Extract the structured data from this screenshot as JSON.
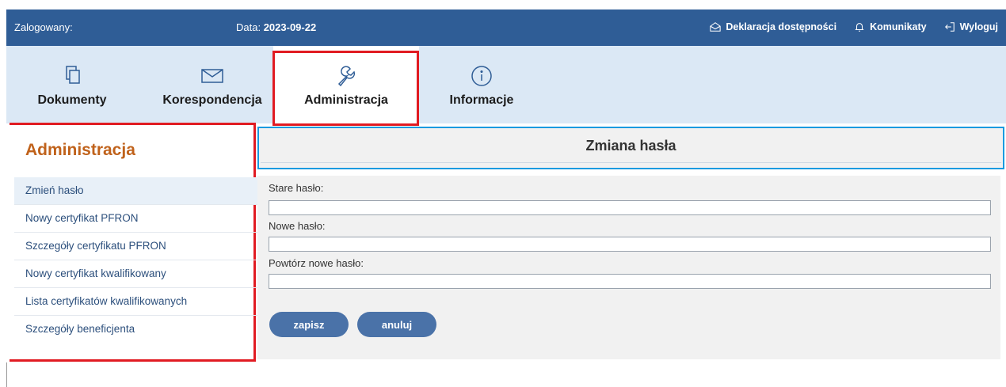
{
  "topbar": {
    "login_label": "Zalogowany:",
    "date_label": "Data:",
    "date_value": "2023-09-22",
    "links": {
      "declaration": "Deklaracja dostępności",
      "messages": "Komunikaty",
      "logout": "Wyloguj"
    }
  },
  "nav": {
    "documents": "Dokumenty",
    "correspondence": "Korespondencja",
    "administration": "Administracja",
    "information": "Informacje"
  },
  "sidebar": {
    "title": "Administracja",
    "items": [
      "Zmień hasło",
      "Nowy certyfikat PFRON",
      "Szczegóły certyfikatu PFRON",
      "Nowy certyfikat kwalifikowany",
      "Lista certyfikatów kwalifikowanych",
      "Szczegóły beneficjenta"
    ]
  },
  "main": {
    "title": "Zmiana hasła",
    "fields": {
      "old_password_label": "Stare hasło:",
      "new_password_label": "Nowe hasło:",
      "repeat_password_label": "Powtórz nowe hasło:"
    },
    "buttons": {
      "save": "zapisz",
      "cancel": "anuluj"
    }
  },
  "colors": {
    "topbar": "#2f5d96",
    "nav": "#dbe8f5",
    "highlight_red": "#e11b22",
    "highlight_blue": "#1a9ae0",
    "sidebar_title": "#c0621b",
    "button": "#4a72a8"
  }
}
